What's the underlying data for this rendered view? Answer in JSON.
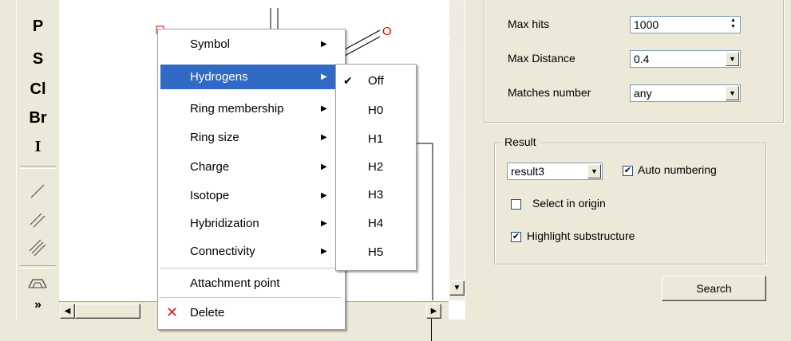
{
  "toolbar": {
    "symbols": [
      "P",
      "S",
      "Cl",
      "Br",
      "I"
    ],
    "more_glyph": "»"
  },
  "canvas": {
    "atom_label": "O"
  },
  "context_menu": {
    "items": [
      {
        "label": "Symbol",
        "submenu": true
      },
      {
        "label": "Hydrogens",
        "submenu": true,
        "selected": true
      },
      {
        "label": "Ring membership",
        "submenu": true
      },
      {
        "label": "Ring size",
        "submenu": true
      },
      {
        "label": "Charge",
        "submenu": true
      },
      {
        "label": "Isotope",
        "submenu": true
      },
      {
        "label": "Hybridization",
        "submenu": true
      },
      {
        "label": "Connectivity",
        "submenu": true
      }
    ],
    "attachment_point": "Attachment point",
    "delete": "Delete"
  },
  "hydrogens_submenu": {
    "items": [
      {
        "label": "Off",
        "checked": true
      },
      {
        "label": "H0"
      },
      {
        "label": "H1"
      },
      {
        "label": "H2"
      },
      {
        "label": "H3"
      },
      {
        "label": "H4"
      },
      {
        "label": "H5"
      }
    ]
  },
  "search_options": {
    "max_hits_label": "Max hits",
    "max_hits_value": "1000",
    "max_distance_label": "Max Distance",
    "max_distance_value": "0.4",
    "matches_number_label": "Matches number",
    "matches_number_value": "any"
  },
  "result": {
    "group_label": "Result",
    "result_select": "result3",
    "auto_numbering_label": "Auto numbering",
    "auto_numbering_checked": true,
    "select_in_origin_label": "Select in origin",
    "select_in_origin_checked": false,
    "highlight_label": "Highlight substructure",
    "highlight_checked": true
  },
  "search_button": "Search",
  "colors": {
    "menu_highlight": "#316ac5",
    "atom_red": "#e00000",
    "face": "#ece9d8"
  }
}
